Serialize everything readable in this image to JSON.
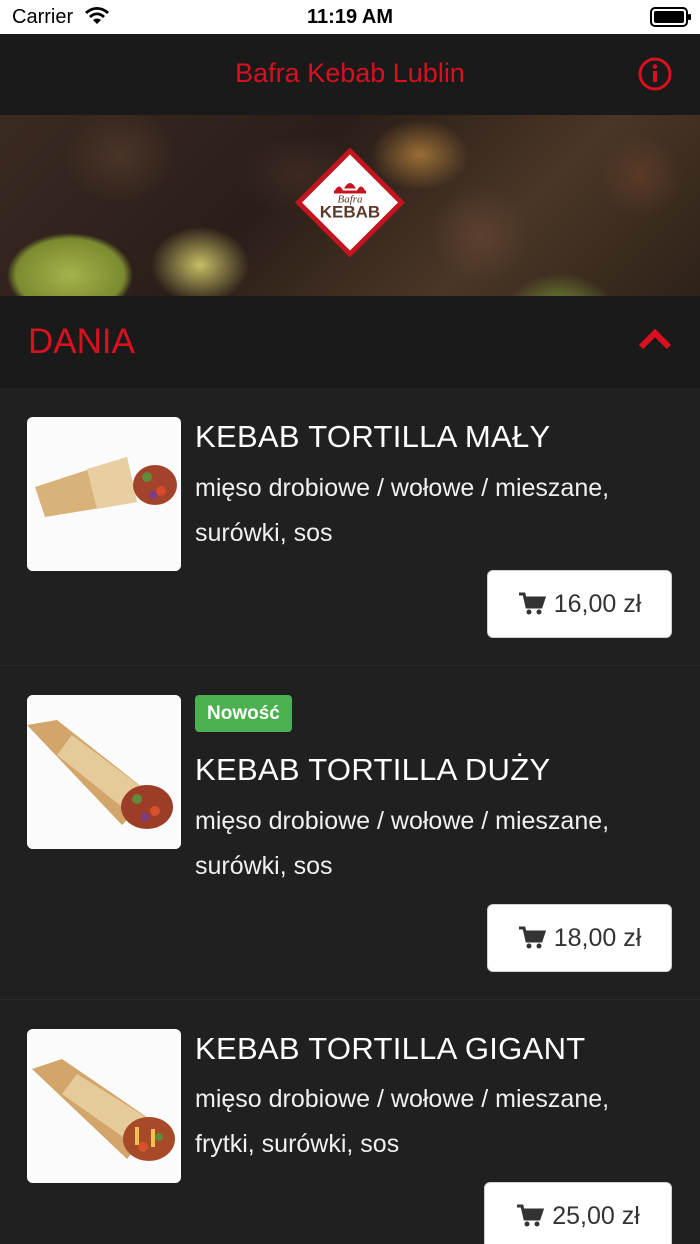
{
  "status_bar": {
    "carrier": "Carrier",
    "time": "11:19 AM"
  },
  "nav": {
    "title": "Bafra Kebab Lublin"
  },
  "hero": {
    "logo_text_top": "Bafra",
    "logo_text_bottom": "KEBAB"
  },
  "section": {
    "label": "DANIA"
  },
  "accent": "#d8101f",
  "items": [
    {
      "name": "KEBAB TORTILLA MAŁY",
      "desc": "mięso drobiowe / wołowe / mieszane, surówki, sos",
      "price": "16,00 zł",
      "badge": null
    },
    {
      "name": "KEBAB TORTILLA DUŻY",
      "desc": "mięso drobiowe / wołowe / mieszane, surówki, sos",
      "price": "18,00 zł",
      "badge": "Nowość"
    },
    {
      "name": "KEBAB TORTILLA GIGANT",
      "desc": "mięso drobiowe / wołowe / mieszane, frytki, surówki, sos",
      "price": "25,00 zł",
      "badge": null
    }
  ]
}
